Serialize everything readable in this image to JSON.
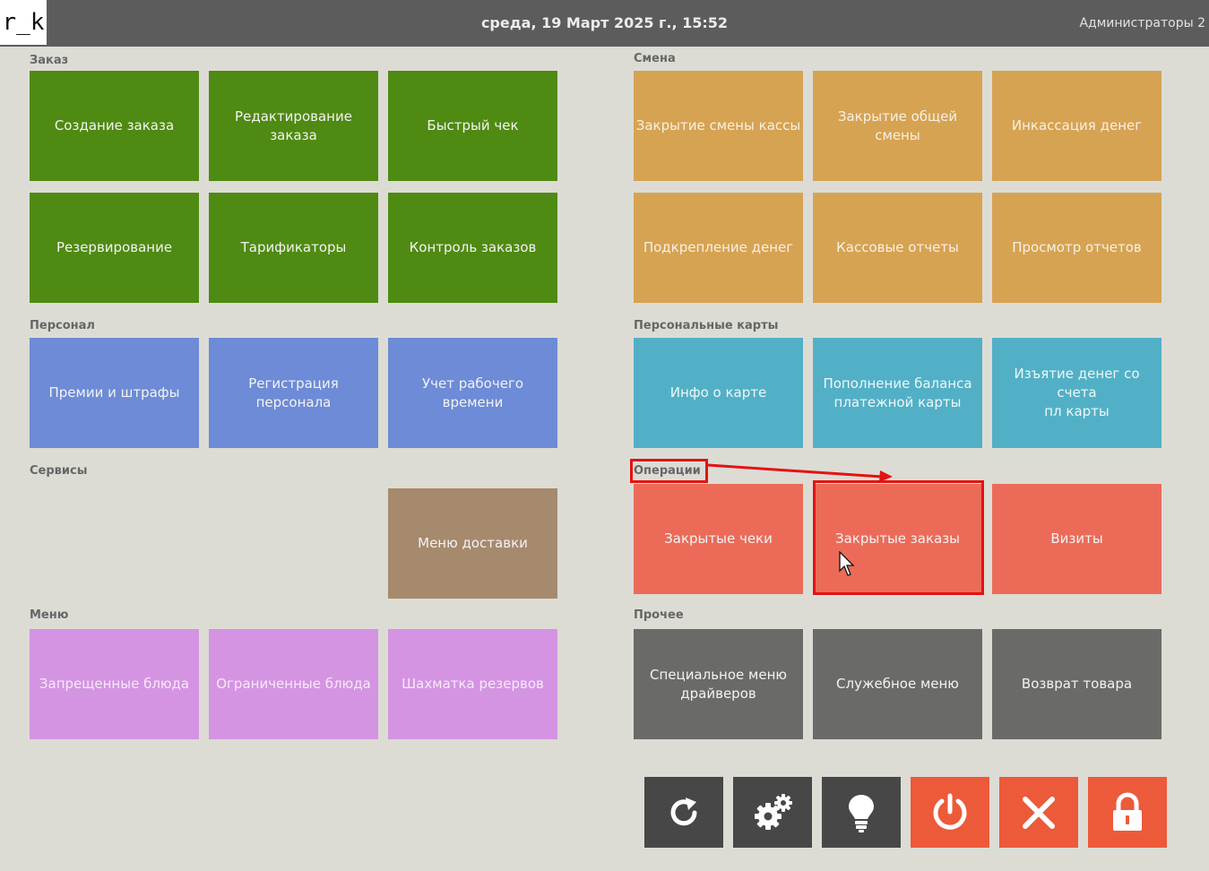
{
  "header": {
    "logo": "r_k",
    "datetime": "среда, 19 Март 2025 г., 15:52",
    "user": "Администраторы 2"
  },
  "sections": {
    "order": "Заказ",
    "shift": "Смена",
    "personnel": "Персонал",
    "cards": "Персональные карты",
    "services": "Сервисы",
    "operations": "Операции",
    "menu": "Меню",
    "other": "Прочее"
  },
  "tiles": {
    "order": [
      "Создание заказа",
      "Редактирование заказа",
      "Быстрый чек",
      "Резервирование",
      "Тарификаторы",
      "Контроль заказов"
    ],
    "shift": [
      "Закрытие смены кассы",
      "Закрытие общей смены",
      "Инкассация денег",
      "Подкрепление денег",
      "Кассовые отчеты",
      "Просмотр отчетов"
    ],
    "personnel": [
      "Премии и штрафы",
      "Регистрация персонала",
      "Учет рабочего времени"
    ],
    "cards": [
      "Инфо о карте",
      "Пополнение баланса\nплатежной карты",
      "Изъятие денег со счета\nпл карты"
    ],
    "services": [
      "Меню доставки"
    ],
    "operations": [
      "Закрытые чеки",
      "Закрытые заказы",
      "Визиты"
    ],
    "menu": [
      "Запрещенные блюда",
      "Ограниченные блюда",
      "Шахматка резервов"
    ],
    "other": [
      "Специальное меню\nдрайверов",
      "Служебное меню",
      "Возврат товара"
    ]
  },
  "colors": {
    "order": "#4f8a12",
    "shift": "#d6a353",
    "personnel": "#6d8bd6",
    "cards": "#52b0c6",
    "services": "#a68a6e",
    "operations": "#ec6b58",
    "menu": "#d494e2",
    "other": "#6a6a68",
    "highlight": "#e41212"
  },
  "bottom_buttons": [
    "refresh-icon",
    "gears-icon",
    "lightbulb-icon",
    "power-icon",
    "close-icon",
    "lock-icon"
  ]
}
